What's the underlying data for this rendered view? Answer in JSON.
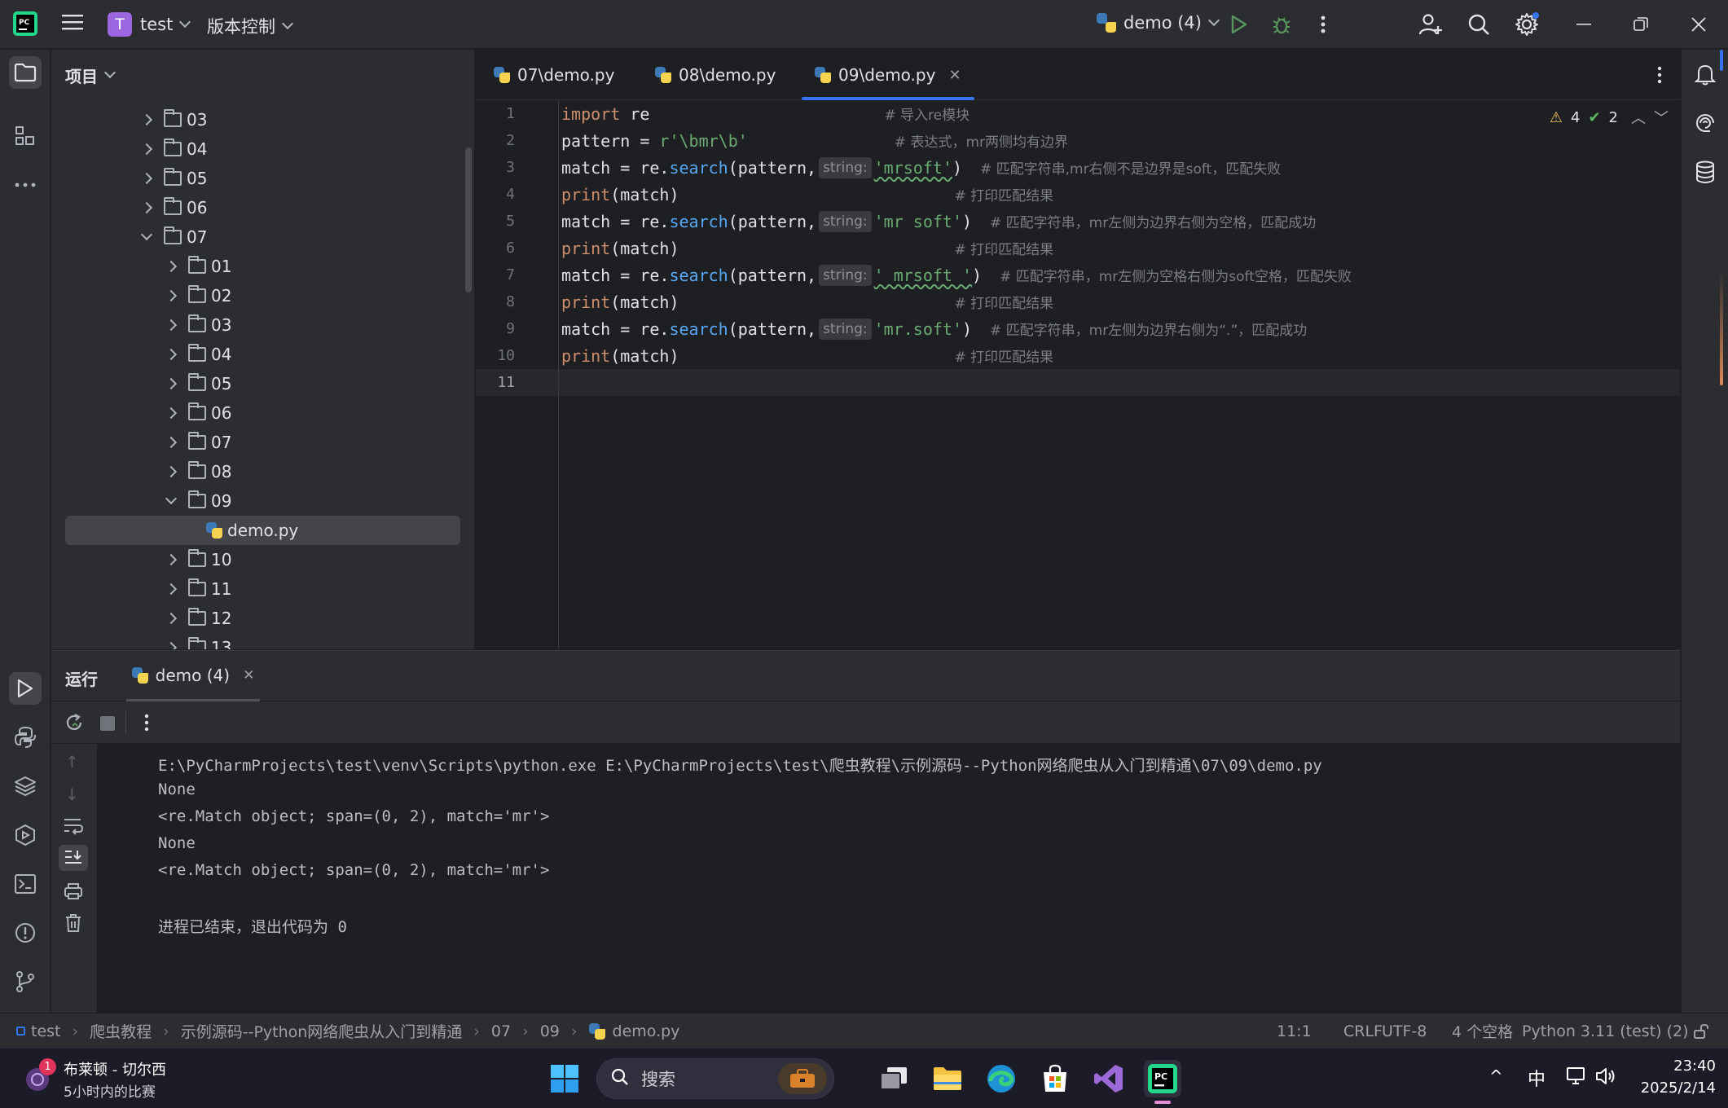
{
  "titlebar": {
    "project_initial": "T",
    "project_name": "test",
    "vcs_label": "版本控制",
    "run_config": "demo (4)"
  },
  "project_panel": {
    "title": "项目",
    "tree": [
      {
        "label": "03",
        "depth": 1,
        "open": false
      },
      {
        "label": "04",
        "depth": 1,
        "open": false
      },
      {
        "label": "05",
        "depth": 1,
        "open": false
      },
      {
        "label": "06",
        "depth": 1,
        "open": false
      },
      {
        "label": "07",
        "depth": 1,
        "open": true
      },
      {
        "label": "01",
        "depth": 2,
        "open": false
      },
      {
        "label": "02",
        "depth": 2,
        "open": false
      },
      {
        "label": "03",
        "depth": 2,
        "open": false
      },
      {
        "label": "04",
        "depth": 2,
        "open": false
      },
      {
        "label": "05",
        "depth": 2,
        "open": false
      },
      {
        "label": "06",
        "depth": 2,
        "open": false
      },
      {
        "label": "07",
        "depth": 2,
        "open": false
      },
      {
        "label": "08",
        "depth": 2,
        "open": false
      },
      {
        "label": "09",
        "depth": 2,
        "open": true
      },
      {
        "label": "demo.py",
        "depth": 3,
        "file": true
      },
      {
        "label": "10",
        "depth": 2,
        "open": false
      },
      {
        "label": "11",
        "depth": 2,
        "open": false
      },
      {
        "label": "12",
        "depth": 2,
        "open": false
      },
      {
        "label": "13",
        "depth": 2,
        "open": false
      }
    ]
  },
  "editor": {
    "tabs": [
      {
        "label": "07\\demo.py"
      },
      {
        "label": "08\\demo.py"
      },
      {
        "label": "09\\demo.py",
        "active": true
      }
    ],
    "warnings": "4",
    "ok": "2",
    "line_numbers": [
      "1",
      "2",
      "3",
      "4",
      "5",
      "6",
      "7",
      "8",
      "9",
      "10",
      "11"
    ],
    "comments": {
      "c1": "# 导入re模块",
      "c2": "# 表达式，mr两侧均有边界",
      "c3": "# 匹配字符串,mr右侧不是边界是soft，匹配失败",
      "c4": "# 打印匹配结果",
      "c5": "# 匹配字符串，mr左侧为边界右侧为空格，匹配成功",
      "c6": "# 打印匹配结果",
      "c7": "# 匹配字符串，mr左侧为空格右侧为soft空格，匹配失败",
      "c8": "# 打印匹配结果",
      "c9": "# 匹配字符串，mr左侧为边界右侧为“.”，匹配成功",
      "c10": "# 打印匹配结果"
    },
    "hint_label": "string:",
    "strings": {
      "pattern": "r'\\bmr\\b'",
      "s3": "'mrsoft'",
      "s5": "'mr soft'",
      "s7": "' mrsoft '",
      "s9": "'mr.soft'"
    }
  },
  "run_panel": {
    "title": "运行",
    "tab": "demo (4)",
    "output": [
      "E:\\PyCharmProjects\\test\\venv\\Scripts\\python.exe E:\\PyCharmProjects\\test\\爬虫教程\\示例源码--Python网络爬虫从入门到精通\\07\\09\\demo.py",
      "None",
      "<re.Match object; span=(0, 2), match='mr'>",
      "None",
      "<re.Match object; span=(0, 2), match='mr'>",
      "",
      "进程已结束，退出代码为 0"
    ]
  },
  "statusbar": {
    "breadcrumbs": [
      "test",
      "爬虫教程",
      "示例源码--Python网络爬虫从入门到精通",
      "07",
      "09",
      "demo.py"
    ],
    "position": "11:1",
    "line_sep": "CRLF",
    "encoding": "UTF-8",
    "indent": "4 个空格",
    "interpreter": "Python 3.11 (test) (2)"
  },
  "taskbar": {
    "widget_title": "布莱顿 - 切尔西",
    "widget_sub": "5小时内的比赛",
    "widget_badge": "1",
    "search_placeholder": "搜索",
    "ime": "中",
    "time": "23:40",
    "date": "2025/2/14"
  },
  "colors": {
    "accent": "#3574f0",
    "keyword": "#cf8e6d",
    "function": "#56a8f5",
    "string": "#6aab73",
    "comment": "#7a7e85"
  }
}
